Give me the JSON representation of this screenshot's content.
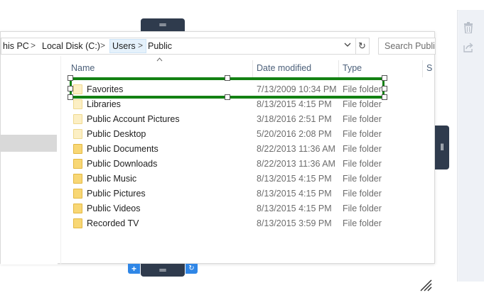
{
  "address_bar": {
    "crumbs": [
      "his PC",
      "Local Disk (C:)",
      "Users",
      "Public"
    ],
    "dropdown_glyph": "⌄",
    "refresh_glyph": "↻"
  },
  "search": {
    "placeholder": "Search Public"
  },
  "columns": {
    "name": "Name",
    "date": "Date modified",
    "type": "Type",
    "size": "S"
  },
  "files": [
    {
      "name": "Favorites",
      "date": "7/13/2009 10:34 PM",
      "type": "File folder",
      "icon": "folder-icon-light"
    },
    {
      "name": "Libraries",
      "date": "8/13/2015 4:15 PM",
      "type": "File folder",
      "icon": "folder-icon-light"
    },
    {
      "name": "Public Account Pictures",
      "date": "3/18/2016 2:51 PM",
      "type": "File folder",
      "icon": "folder-icon-light"
    },
    {
      "name": "Public Desktop",
      "date": "5/20/2016 2:08 PM",
      "type": "File folder",
      "icon": "folder-icon-light"
    },
    {
      "name": "Public Documents",
      "date": "8/22/2013 11:36 AM",
      "type": "File folder",
      "icon": "folder-icon"
    },
    {
      "name": "Public Downloads",
      "date": "8/22/2013 11:36 AM",
      "type": "File folder",
      "icon": "folder-icon"
    },
    {
      "name": "Public Music",
      "date": "8/13/2015 4:15 PM",
      "type": "File folder",
      "icon": "folder-icon"
    },
    {
      "name": "Public Pictures",
      "date": "8/13/2015 4:15 PM",
      "type": "File folder",
      "icon": "folder-icon"
    },
    {
      "name": "Public Videos",
      "date": "8/13/2015 4:15 PM",
      "type": "File folder",
      "icon": "folder-icon"
    },
    {
      "name": "Recorded TV",
      "date": "8/13/2015 3:59 PM",
      "type": "File folder",
      "icon": "folder-icon"
    }
  ],
  "editor": {
    "drag_handle_glyph": "═",
    "side_handle_glyph": "‖",
    "add_glyph": "+",
    "cycle_glyph": "↻",
    "selection_color": "#138113",
    "handle_color": "#2f3b4d",
    "button_color": "#2f86e6"
  },
  "right_rail": {
    "icons": [
      "trash-icon",
      "share-icon"
    ]
  }
}
